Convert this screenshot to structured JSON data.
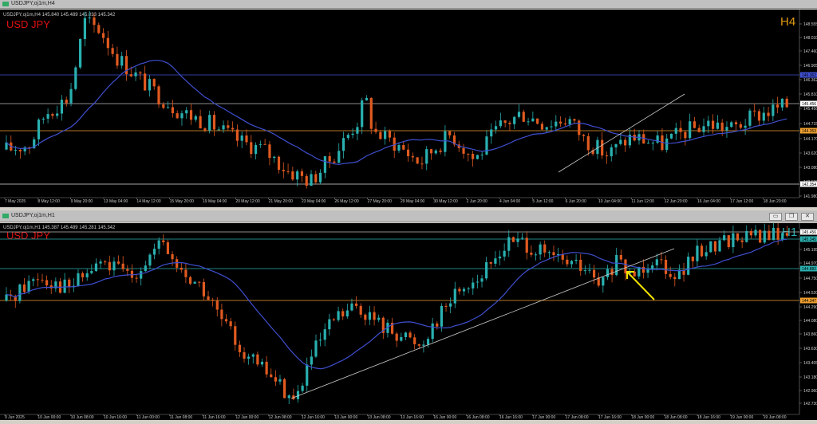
{
  "windows": [
    {
      "title": "USDJPY,oj1m,H4",
      "info": "USDJPY,oj1m,H4  145.840 145.489 145.033 145.342",
      "symbol_label": "USD JPY",
      "timeframe_label": "H4",
      "colors": {
        "symbol": "#e01010",
        "timeframe": "#e09a10",
        "ma": "#3f4fd0",
        "bull": "#2ab0b0",
        "bear": "#e05a20",
        "support": "#f0a030",
        "resistance": "#3f4fd0"
      },
      "y_labels": [
        "148.555",
        "148.010",
        "147.460",
        "146.905",
        "146.362",
        "145.810",
        "145.456",
        "144.715",
        "144.170",
        "143.620",
        "143.080",
        "142.530",
        "141.980"
      ],
      "price_markers": [
        {
          "price": "146.362",
          "kind": "resistance"
        },
        {
          "price": "145.456",
          "kind": "current"
        },
        {
          "price": "144.353",
          "kind": "support"
        },
        {
          "price": "142.354",
          "kind": "support"
        }
      ],
      "x_labels": [
        "7 May 2025",
        "8 May 12:00",
        "9 May 20:00",
        "13 May 04:00",
        "14 May 12:00",
        "15 May 20:00",
        "19 May 04:00",
        "20 May 12:00",
        "21 May 20:00",
        "23 May 04:00",
        "26 May 12:00",
        "27 May 20:00",
        "29 May 04:00",
        "30 May 12:00",
        "2 Jun 20:00",
        "4 Jun 04:00",
        "5 Jun 12:00",
        "6 Jun 20:00",
        "10 Jun 04:00",
        "11 Jun 12:00",
        "12 Jun 20:00",
        "16 Jun 04:00",
        "17 Jun 12:00",
        "18 Jun 20:00"
      ]
    },
    {
      "title": "USDJPY,oj1m,H1",
      "info": "USDJPY,oj1m,H1  145.387 145.489 145.281 145.342",
      "symbol_label": "USD JPY",
      "timeframe_label": "H1",
      "colors": {
        "symbol": "#e01010",
        "timeframe": "#2ab0b0",
        "ma": "#3f4fd0",
        "bull": "#2ab0b0",
        "bear": "#e05a20",
        "support": "#f0a030",
        "resistance": "#2ab0b0",
        "arrow": "#f2e000"
      },
      "y_labels": [
        "145.456",
        "145.345",
        "145.195",
        "144.970",
        "144.750",
        "144.520",
        "144.290",
        "144.080",
        "143.860",
        "143.630",
        "143.405",
        "143.180",
        "142.960",
        "142.730"
      ],
      "price_markers": [
        {
          "price": "145.456",
          "kind": "current"
        },
        {
          "price": "145.345",
          "kind": "resistance"
        },
        {
          "price": "144.882",
          "kind": "resistance"
        },
        {
          "price": "144.347",
          "kind": "support"
        }
      ],
      "x_labels": [
        "9 Jun 2025",
        "10 Jun 00:00",
        "10 Jun 08:00",
        "10 Jun 16:00",
        "11 Jun 00:00",
        "11 Jun 08:00",
        "11 Jun 16:00",
        "12 Jun 00:00",
        "12 Jun 08:00",
        "12 Jun 16:00",
        "13 Jun 00:00",
        "13 Jun 08:00",
        "13 Jun 16:00",
        "16 Jun 00:00",
        "16 Jun 08:00",
        "16 Jun 16:00",
        "17 Jun 00:00",
        "17 Jun 08:00",
        "17 Jun 16:00",
        "18 Jun 00:00",
        "18 Jun 08:00",
        "18 Jun 16:00",
        "19 Jun 00:00",
        "19 Jun 08:00"
      ]
    }
  ]
}
